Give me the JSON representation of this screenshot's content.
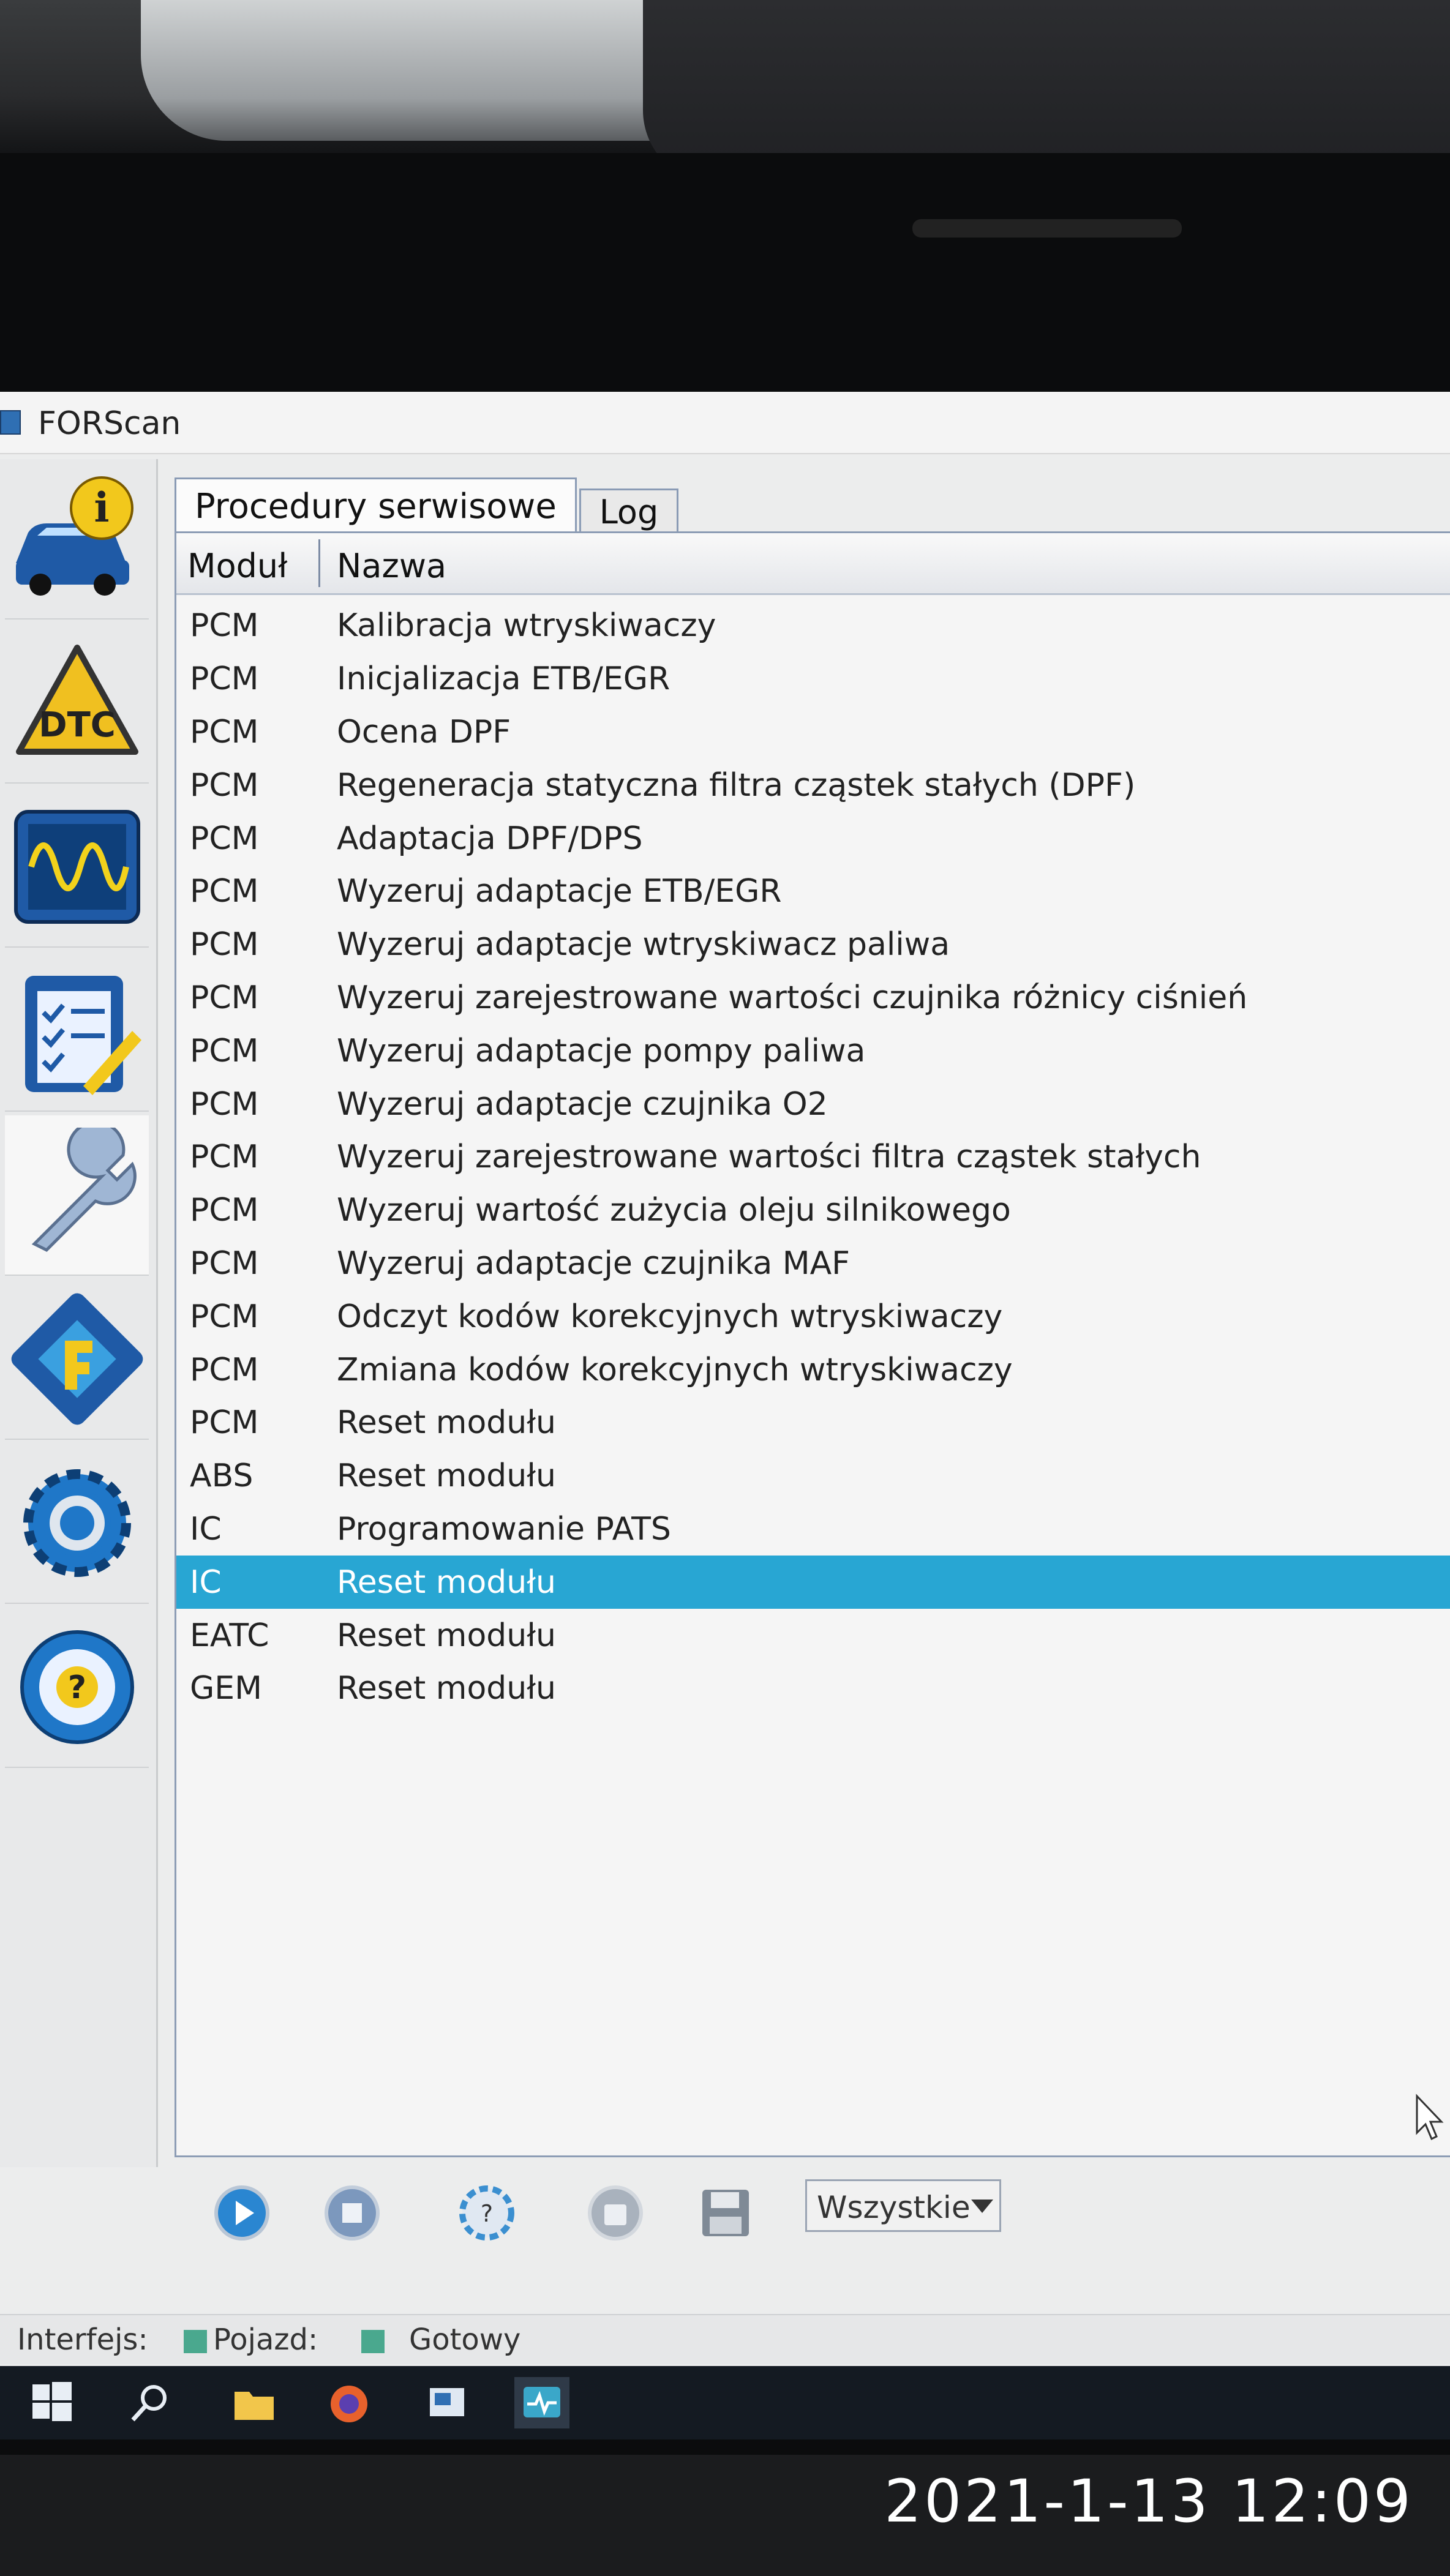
{
  "window": {
    "title": "FORScan"
  },
  "sidebar": {
    "tools": [
      {
        "name": "vehicle-info",
        "icon": "car-info-icon"
      },
      {
        "name": "dtc",
        "icon": "dtc-warning-icon",
        "label": "DTC"
      },
      {
        "name": "oscilloscope",
        "icon": "oscilloscope-icon"
      },
      {
        "name": "tests",
        "icon": "checklist-icon"
      },
      {
        "name": "service",
        "icon": "wrench-icon",
        "active": true
      },
      {
        "name": "configuration",
        "icon": "chip-icon"
      },
      {
        "name": "settings",
        "icon": "gear-icon"
      },
      {
        "name": "help",
        "icon": "help-wheel-icon",
        "label": "?"
      }
    ]
  },
  "tabs": [
    {
      "label": "Procedury serwisowe",
      "active": true
    },
    {
      "label": "Log",
      "active": false
    }
  ],
  "table": {
    "columns": {
      "module": "Moduł",
      "name": "Nazwa"
    },
    "rows": [
      {
        "module": "PCM",
        "name": "Kalibracja wtryskiwaczy"
      },
      {
        "module": "PCM",
        "name": "Inicjalizacja ETB/EGR"
      },
      {
        "module": "PCM",
        "name": "Ocena DPF"
      },
      {
        "module": "PCM",
        "name": "Regeneracja statyczna filtra cząstek stałych (DPF)"
      },
      {
        "module": "PCM",
        "name": "Adaptacja DPF/DPS"
      },
      {
        "module": "PCM",
        "name": "Wyzeruj adaptacje ETB/EGR"
      },
      {
        "module": "PCM",
        "name": "Wyzeruj adaptacje wtryskiwacz paliwa"
      },
      {
        "module": "PCM",
        "name": "Wyzeruj zarejestrowane wartości czujnika różnicy ciśnień"
      },
      {
        "module": "PCM",
        "name": "Wyzeruj adaptacje pompy paliwa"
      },
      {
        "module": "PCM",
        "name": "Wyzeruj adaptacje czujnika O2"
      },
      {
        "module": "PCM",
        "name": "Wyzeruj zarejestrowane wartości filtra cząstek stałych"
      },
      {
        "module": "PCM",
        "name": "Wyzeruj wartość zużycia oleju silnikowego"
      },
      {
        "module": "PCM",
        "name": "Wyzeruj adaptacje czujnika MAF"
      },
      {
        "module": "PCM",
        "name": "Odczyt kodów korekcyjnych wtryskiwaczy"
      },
      {
        "module": "PCM",
        "name": "Zmiana kodów korekcyjnych wtryskiwaczy"
      },
      {
        "module": "PCM",
        "name": "Reset modułu"
      },
      {
        "module": "ABS",
        "name": "Reset modułu"
      },
      {
        "module": "IC",
        "name": "Programowanie PATS"
      },
      {
        "module": "IC",
        "name": "Reset modułu",
        "selected": true
      },
      {
        "module": "EATC",
        "name": "Reset modułu"
      },
      {
        "module": "GEM",
        "name": "Reset modułu"
      }
    ]
  },
  "toolbar": {
    "buttons": [
      "run-icon",
      "stop-icon",
      "help-icon",
      "clear-icon",
      "save-icon"
    ],
    "filter": {
      "selected": "Wszystkie"
    }
  },
  "status": {
    "interface_label": "Interfejs:",
    "vehicle_label": "Pojazd:",
    "state_label": "Gotowy",
    "led_color": "#4aa88e"
  },
  "taskbar": {
    "buttons": [
      "windows-start-icon",
      "search-icon",
      "file-explorer-icon",
      "firefox-icon",
      "app-icon",
      "forscan-taskbar-icon"
    ]
  },
  "photo": {
    "timestamp": "2021-1-13 12:09"
  },
  "colors": {
    "selection": "#28a6d3",
    "tab_border": "#8a9bb5"
  }
}
